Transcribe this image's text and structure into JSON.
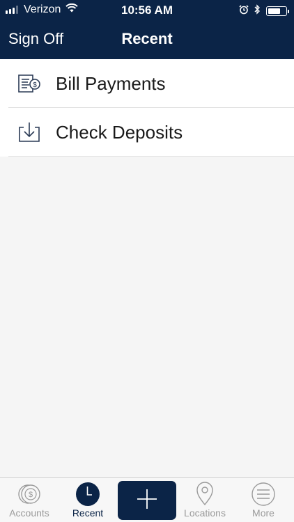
{
  "status_bar": {
    "carrier": "Verizon",
    "time": "10:56 AM"
  },
  "nav": {
    "left_button": "Sign Off",
    "title": "Recent"
  },
  "list": [
    {
      "label": "Bill Payments",
      "icon": "bill-payment-icon"
    },
    {
      "label": "Check Deposits",
      "icon": "check-deposit-icon"
    }
  ],
  "tabbar": {
    "tabs": [
      {
        "label": "Accounts",
        "icon": "dollar-coin-icon"
      },
      {
        "label": "Recent",
        "icon": "clock-icon",
        "active": true
      },
      {
        "label": "",
        "icon": "plus-icon"
      },
      {
        "label": "Locations",
        "icon": "map-pin-icon"
      },
      {
        "label": "More",
        "icon": "menu-icon"
      }
    ]
  },
  "colors": {
    "brand": "#0b2447",
    "background": "#f5f5f5",
    "inactive_tab": "#9a9a9a"
  }
}
